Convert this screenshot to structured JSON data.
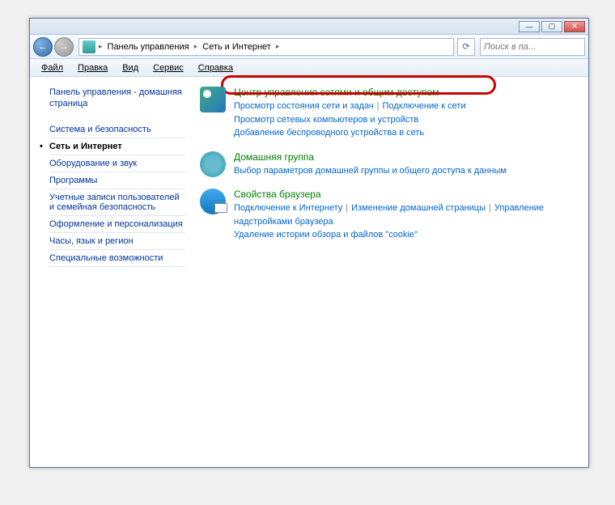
{
  "titlebar": {
    "minimize": "—",
    "maximize": "▢",
    "close": "✕"
  },
  "nav": {
    "back": "←",
    "fwd": "→",
    "refresh": "⟳"
  },
  "breadcrumb": {
    "items": [
      "Панель управления",
      "Сеть и Интернет"
    ],
    "arrow": "▸"
  },
  "search": {
    "placeholder": "Поиск в па..."
  },
  "menu": {
    "file": "Файл",
    "edit": "Правка",
    "view": "Вид",
    "tools": "Сервис",
    "help": "Справка"
  },
  "sidebar": {
    "home": "Панель управления - домашняя страница",
    "items": [
      {
        "label": "Система и безопасность",
        "current": false
      },
      {
        "label": "Сеть и Интернет",
        "current": true
      },
      {
        "label": "Оборудование и звук",
        "current": false
      },
      {
        "label": "Программы",
        "current": false
      },
      {
        "label": "Учетные записи пользователей и семейная безопасность",
        "current": false
      },
      {
        "label": "Оформление и персонализация",
        "current": false
      },
      {
        "label": "Часы, язык и регион",
        "current": false
      },
      {
        "label": "Специальные возможности",
        "current": false
      }
    ]
  },
  "content": {
    "cats": [
      {
        "icon": "network-sharing-icon",
        "title": "Центр управления сетями и общим доступом",
        "highlighted": true,
        "subs": [
          "Просмотр состояния сети и задач",
          "Подключение к сети",
          "Просмотр сетевых компьютеров и устройств",
          "Добавление беспроводного устройства в сеть"
        ],
        "sepAfter": [
          0
        ]
      },
      {
        "icon": "homegroup-icon",
        "title": "Домашняя группа",
        "subs": [
          "Выбор параметров домашней группы и общего доступа к данным"
        ],
        "sepAfter": []
      },
      {
        "icon": "browser-props-icon",
        "title": "Свойства браузера",
        "subs": [
          "Подключение к Интернету",
          "Изменение домашней страницы",
          "Управление надстройками браузера",
          "Удаление истории обзора и файлов \"cookie\""
        ],
        "sepAfter": [
          0,
          1
        ]
      }
    ]
  }
}
